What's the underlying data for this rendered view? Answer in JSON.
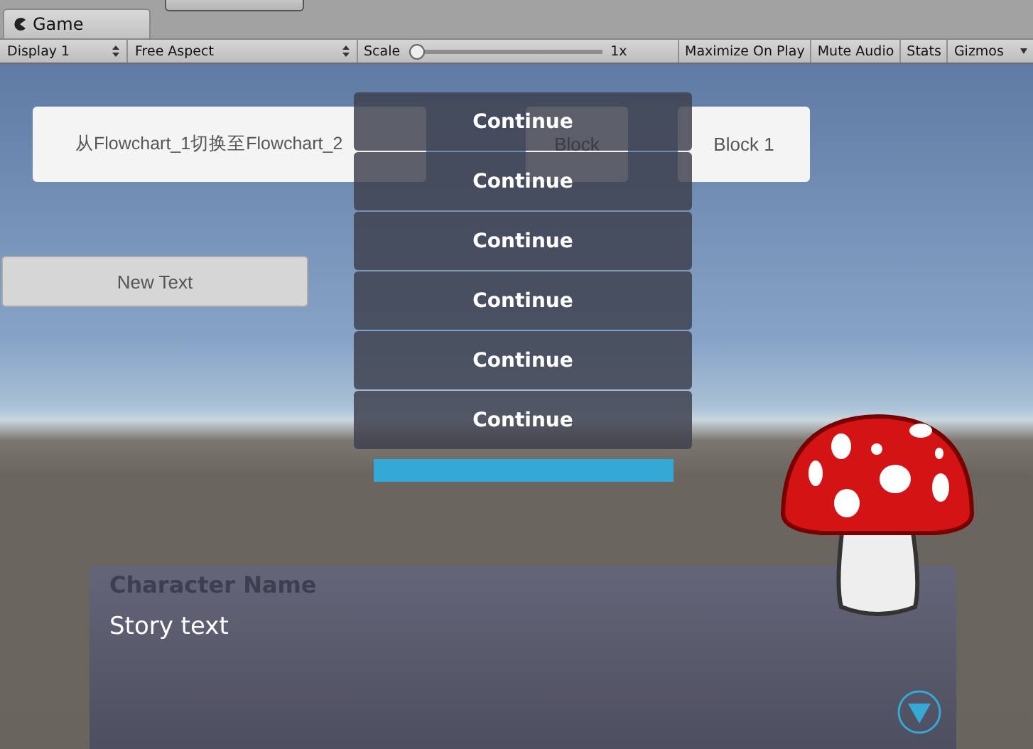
{
  "tab": {
    "title": "Game",
    "selected": true
  },
  "toolbar": {
    "display": "Display 1",
    "aspect": "Free Aspect",
    "scale_label": "Scale",
    "scale": {
      "level": 0.0
    },
    "scale_reading": "1x",
    "toggles": [
      {
        "label": "Maximize On Play",
        "on": false
      },
      {
        "label": "Mute Audio",
        "on": false
      },
      {
        "label": "Stats",
        "on": false
      }
    ],
    "gizmos": "Gizmos"
  },
  "game": {
    "top_buttons": [
      "从Flowchart_1切换至Flowchart_2",
      "Block",
      "Block 1"
    ],
    "new_text_button": "New Text",
    "menu_options": [
      "Continue",
      "Continue",
      "Continue",
      "Continue",
      "Continue",
      "Continue"
    ],
    "timer": {
      "level": 1.0
    },
    "say_dialog": {
      "character_name": "Character Name",
      "story_text": "Story text"
    }
  }
}
